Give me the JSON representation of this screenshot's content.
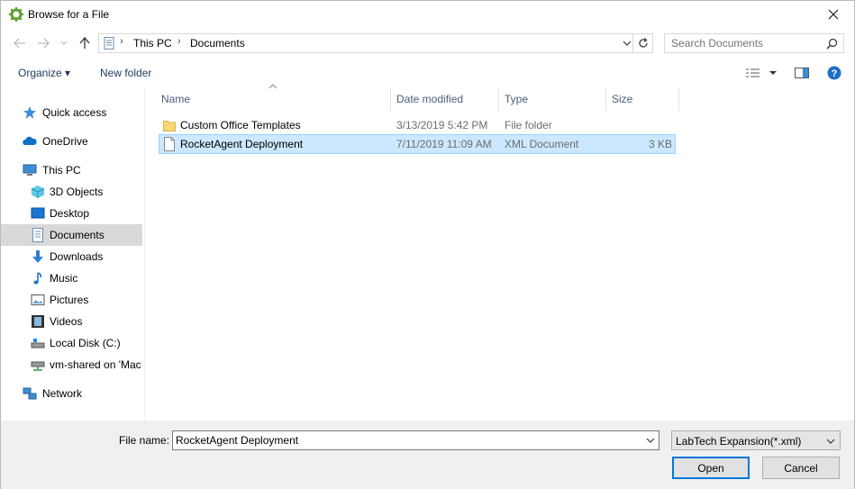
{
  "window": {
    "title": "Browse for a File"
  },
  "address": {
    "crumbs": [
      "This PC",
      "Documents"
    ],
    "sep": "›"
  },
  "search": {
    "placeholder": "Search Documents"
  },
  "toolbar": {
    "organize_label": "Organize ▾",
    "new_folder_label": "New folder"
  },
  "sidebar": {
    "items": [
      {
        "label": "Quick access",
        "icon": "star-icon"
      },
      {
        "label": "OneDrive",
        "icon": "cloud-icon"
      },
      {
        "label": "This PC",
        "icon": "computer-icon"
      },
      {
        "label": "3D Objects",
        "icon": "cube-icon"
      },
      {
        "label": "Desktop",
        "icon": "desktop-icon"
      },
      {
        "label": "Documents",
        "icon": "document-icon"
      },
      {
        "label": "Downloads",
        "icon": "download-arrow-icon"
      },
      {
        "label": "Music",
        "icon": "music-note-icon"
      },
      {
        "label": "Pictures",
        "icon": "picture-icon"
      },
      {
        "label": "Videos",
        "icon": "film-icon"
      },
      {
        "label": "Local Disk (C:)",
        "icon": "drive-icon"
      },
      {
        "label": "vm-shared on 'Mac",
        "icon": "network-drive-icon"
      },
      {
        "label": "Network",
        "icon": "network-icon"
      }
    ]
  },
  "columns": {
    "name": "Name",
    "date": "Date modified",
    "type": "Type",
    "size": "Size"
  },
  "files": [
    {
      "name": "Custom Office Templates",
      "date": "3/13/2019 5:42 PM",
      "type": "File folder",
      "size": ""
    },
    {
      "name": "RocketAgent Deployment",
      "date": "7/11/2019 11:09 AM",
      "type": "XML Document",
      "size": "3 KB"
    }
  ],
  "bottom": {
    "file_name_label": "File name:",
    "file_name_value": "RocketAgent Deployment",
    "file_type_value": "LabTech Expansion(*.xml)",
    "open_label": "Open",
    "cancel_label": "Cancel"
  },
  "colors": {
    "selection_bg": "#cce8ff",
    "selection_border": "#99d1ff",
    "accent": "#0078d7",
    "sidebar_selected": "#d9d9d9"
  }
}
